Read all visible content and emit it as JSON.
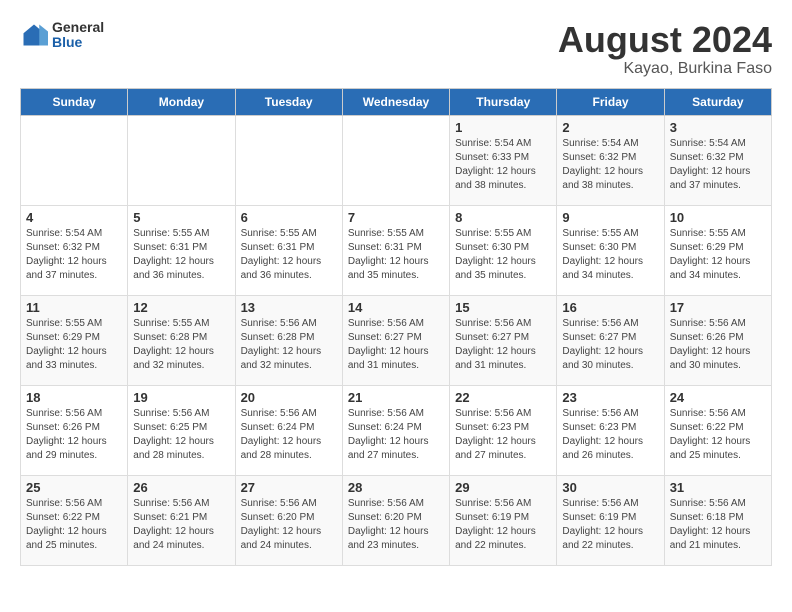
{
  "header": {
    "logo": {
      "general": "General",
      "blue": "Blue"
    },
    "title": "August 2024",
    "subtitle": "Kayao, Burkina Faso"
  },
  "days_of_week": [
    "Sunday",
    "Monday",
    "Tuesday",
    "Wednesday",
    "Thursday",
    "Friday",
    "Saturday"
  ],
  "weeks": [
    [
      {
        "day": "",
        "content": ""
      },
      {
        "day": "",
        "content": ""
      },
      {
        "day": "",
        "content": ""
      },
      {
        "day": "",
        "content": ""
      },
      {
        "day": "1",
        "content": "Sunrise: 5:54 AM\nSunset: 6:33 PM\nDaylight: 12 hours\nand 38 minutes."
      },
      {
        "day": "2",
        "content": "Sunrise: 5:54 AM\nSunset: 6:32 PM\nDaylight: 12 hours\nand 38 minutes."
      },
      {
        "day": "3",
        "content": "Sunrise: 5:54 AM\nSunset: 6:32 PM\nDaylight: 12 hours\nand 37 minutes."
      }
    ],
    [
      {
        "day": "4",
        "content": "Sunrise: 5:54 AM\nSunset: 6:32 PM\nDaylight: 12 hours\nand 37 minutes."
      },
      {
        "day": "5",
        "content": "Sunrise: 5:55 AM\nSunset: 6:31 PM\nDaylight: 12 hours\nand 36 minutes."
      },
      {
        "day": "6",
        "content": "Sunrise: 5:55 AM\nSunset: 6:31 PM\nDaylight: 12 hours\nand 36 minutes."
      },
      {
        "day": "7",
        "content": "Sunrise: 5:55 AM\nSunset: 6:31 PM\nDaylight: 12 hours\nand 35 minutes."
      },
      {
        "day": "8",
        "content": "Sunrise: 5:55 AM\nSunset: 6:30 PM\nDaylight: 12 hours\nand 35 minutes."
      },
      {
        "day": "9",
        "content": "Sunrise: 5:55 AM\nSunset: 6:30 PM\nDaylight: 12 hours\nand 34 minutes."
      },
      {
        "day": "10",
        "content": "Sunrise: 5:55 AM\nSunset: 6:29 PM\nDaylight: 12 hours\nand 34 minutes."
      }
    ],
    [
      {
        "day": "11",
        "content": "Sunrise: 5:55 AM\nSunset: 6:29 PM\nDaylight: 12 hours\nand 33 minutes."
      },
      {
        "day": "12",
        "content": "Sunrise: 5:55 AM\nSunset: 6:28 PM\nDaylight: 12 hours\nand 32 minutes."
      },
      {
        "day": "13",
        "content": "Sunrise: 5:56 AM\nSunset: 6:28 PM\nDaylight: 12 hours\nand 32 minutes."
      },
      {
        "day": "14",
        "content": "Sunrise: 5:56 AM\nSunset: 6:27 PM\nDaylight: 12 hours\nand 31 minutes."
      },
      {
        "day": "15",
        "content": "Sunrise: 5:56 AM\nSunset: 6:27 PM\nDaylight: 12 hours\nand 31 minutes."
      },
      {
        "day": "16",
        "content": "Sunrise: 5:56 AM\nSunset: 6:27 PM\nDaylight: 12 hours\nand 30 minutes."
      },
      {
        "day": "17",
        "content": "Sunrise: 5:56 AM\nSunset: 6:26 PM\nDaylight: 12 hours\nand 30 minutes."
      }
    ],
    [
      {
        "day": "18",
        "content": "Sunrise: 5:56 AM\nSunset: 6:26 PM\nDaylight: 12 hours\nand 29 minutes."
      },
      {
        "day": "19",
        "content": "Sunrise: 5:56 AM\nSunset: 6:25 PM\nDaylight: 12 hours\nand 28 minutes."
      },
      {
        "day": "20",
        "content": "Sunrise: 5:56 AM\nSunset: 6:24 PM\nDaylight: 12 hours\nand 28 minutes."
      },
      {
        "day": "21",
        "content": "Sunrise: 5:56 AM\nSunset: 6:24 PM\nDaylight: 12 hours\nand 27 minutes."
      },
      {
        "day": "22",
        "content": "Sunrise: 5:56 AM\nSunset: 6:23 PM\nDaylight: 12 hours\nand 27 minutes."
      },
      {
        "day": "23",
        "content": "Sunrise: 5:56 AM\nSunset: 6:23 PM\nDaylight: 12 hours\nand 26 minutes."
      },
      {
        "day": "24",
        "content": "Sunrise: 5:56 AM\nSunset: 6:22 PM\nDaylight: 12 hours\nand 25 minutes."
      }
    ],
    [
      {
        "day": "25",
        "content": "Sunrise: 5:56 AM\nSunset: 6:22 PM\nDaylight: 12 hours\nand 25 minutes."
      },
      {
        "day": "26",
        "content": "Sunrise: 5:56 AM\nSunset: 6:21 PM\nDaylight: 12 hours\nand 24 minutes."
      },
      {
        "day": "27",
        "content": "Sunrise: 5:56 AM\nSunset: 6:20 PM\nDaylight: 12 hours\nand 24 minutes."
      },
      {
        "day": "28",
        "content": "Sunrise: 5:56 AM\nSunset: 6:20 PM\nDaylight: 12 hours\nand 23 minutes."
      },
      {
        "day": "29",
        "content": "Sunrise: 5:56 AM\nSunset: 6:19 PM\nDaylight: 12 hours\nand 22 minutes."
      },
      {
        "day": "30",
        "content": "Sunrise: 5:56 AM\nSunset: 6:19 PM\nDaylight: 12 hours\nand 22 minutes."
      },
      {
        "day": "31",
        "content": "Sunrise: 5:56 AM\nSunset: 6:18 PM\nDaylight: 12 hours\nand 21 minutes."
      }
    ]
  ]
}
